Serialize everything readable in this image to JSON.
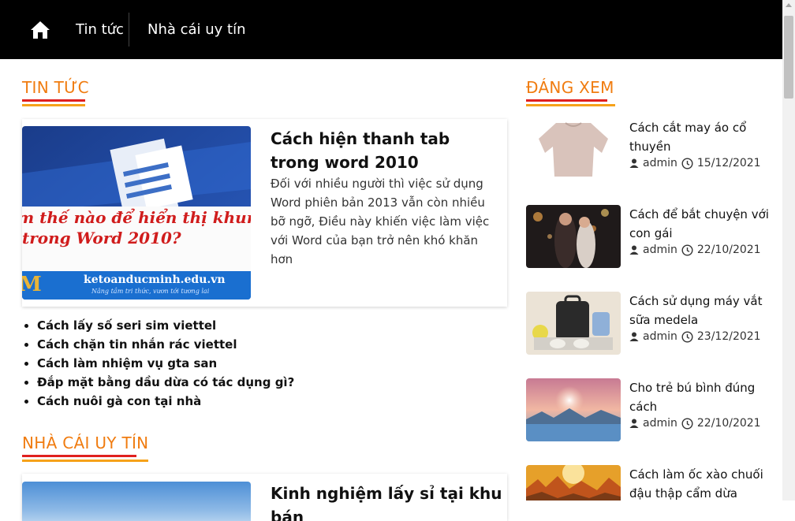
{
  "nav": {
    "home_icon": "home-icon",
    "items": [
      {
        "label": "Tin tức"
      },
      {
        "label": "Nhà cái uy tín"
      }
    ]
  },
  "sections": {
    "news_title": "TIN TỨC",
    "bookmaker_title": "NHÀ CÁI UY TÍN",
    "sidebar_title": "ĐÁNG XEM"
  },
  "featured": {
    "title": "Cách hiện thanh tab trong word 2010",
    "description": "Đối với nhiều người thì việc sử dụng Word phiên bản 2013 vẫn còn nhiều bỡ ngỡ, Điều này khiến việc làm việc với Word của bạn trở nên khó khăn hơn",
    "image_text_line1": "m thế nào để hiển thị khung că",
    "image_text_line2": "trong Word 2010?",
    "image_site": "ketoanducminh.edu.vn",
    "image_slogan": "Nâng tầm tri thức, vươn tới tương lai",
    "image_logo": "M"
  },
  "news_list": [
    "Cách lấy số seri sim viettel",
    "Cách chặn tin nhắn rác viettel",
    "Cách làm nhiệm vụ gta san",
    "Đắp mặt bằng dầu dừa có tác dụng gì?",
    "Cách nuôi gà con tại nhà"
  ],
  "featured2": {
    "title": "Kinh nghiệm lấy sỉ tại khu bán"
  },
  "sidebar": [
    {
      "title": "Cách cắt may áo cổ thuyền",
      "author": "admin",
      "date": "15/12/2021"
    },
    {
      "title": "Cách để bắt chuyện với con gái",
      "author": "admin",
      "date": "22/10/2021"
    },
    {
      "title": "Cách sử dụng máy vắt sữa medela",
      "author": "admin",
      "date": "23/12/2021"
    },
    {
      "title": "Cho trẻ bú bình đúng cách",
      "author": "admin",
      "date": "22/10/2021"
    },
    {
      "title": "Cách làm ốc xào chuối đậu thập cẩm dừa",
      "author": "",
      "date": ""
    }
  ],
  "colors": {
    "accent": "#f07c10",
    "underline_red": "#e0201f",
    "underline_orange": "#f6a21a",
    "topbar": "#000000"
  }
}
